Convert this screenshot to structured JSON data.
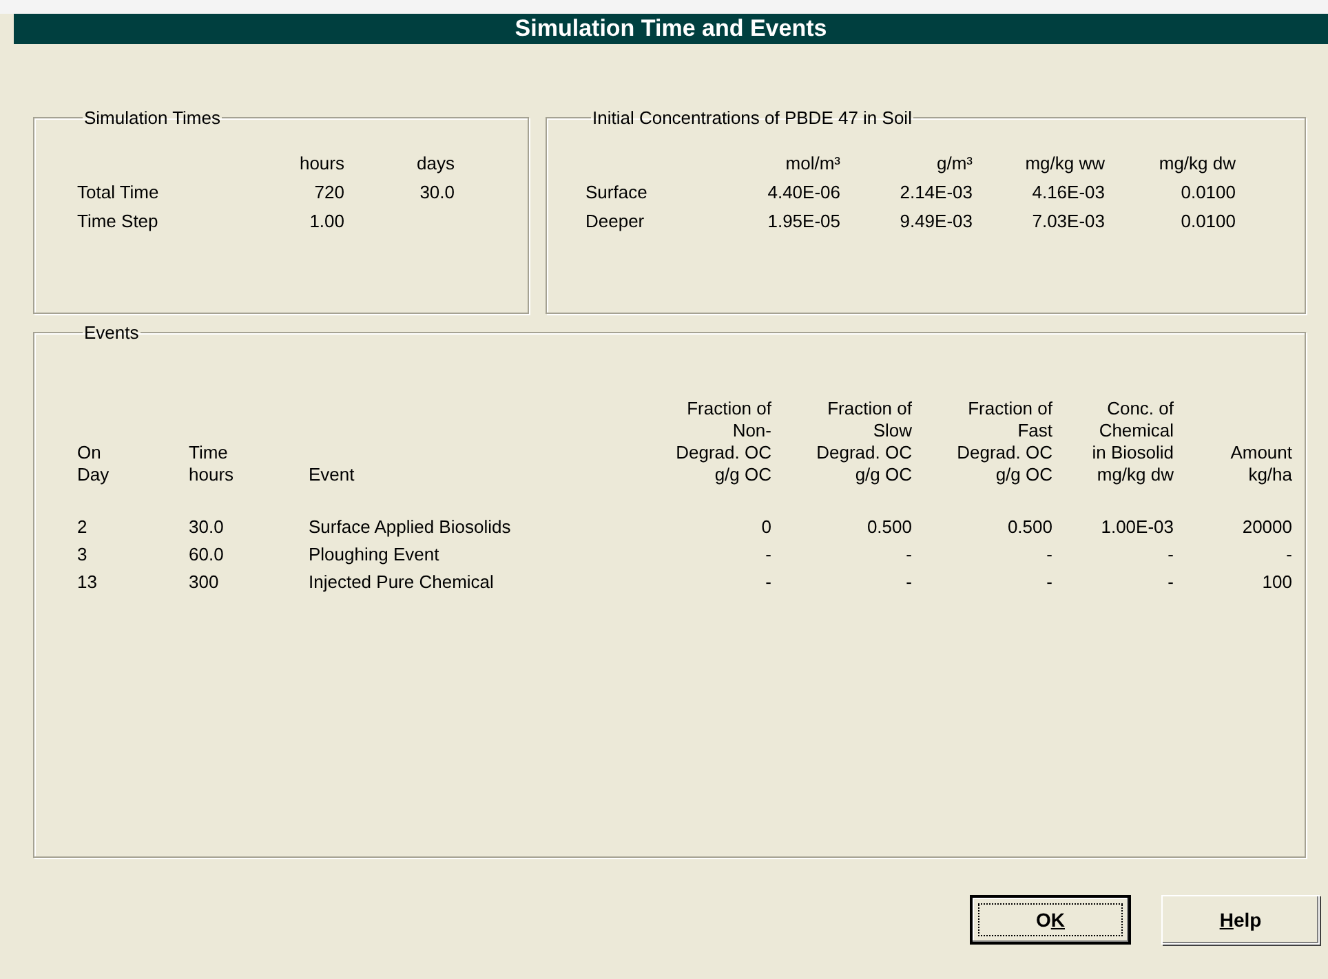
{
  "window": {
    "title": "Simulation Time and Events"
  },
  "simulation_times": {
    "title": "Simulation Times",
    "columns": [
      "hours",
      "days"
    ],
    "rows": [
      {
        "label": "Total Time",
        "values": [
          "720",
          "30.0"
        ]
      },
      {
        "label": "Time Step",
        "values": [
          "1.00"
        ]
      }
    ]
  },
  "initial_concentrations": {
    "title": "Initial Concentrations of PBDE 47 in Soil",
    "columns": [
      "mol/m³",
      "g/m³",
      "mg/kg ww",
      "mg/kg dw"
    ],
    "rows": [
      {
        "label": "Surface",
        "values": [
          "4.40E-06",
          "2.14E-03",
          "4.16E-03",
          "0.0100"
        ]
      },
      {
        "label": "Deeper",
        "values": [
          "1.95E-05",
          "9.49E-03",
          "7.03E-03",
          "0.0100"
        ]
      }
    ]
  },
  "events": {
    "title": "Events",
    "columns": [
      "On\nDay",
      "Time\nhours",
      "Event",
      "Fraction of\nNon-\nDegrad. OC\ng/g OC",
      "Fraction of\nSlow\nDegrad. OC\ng/g OC",
      "Fraction of\nFast\nDegrad. OC\ng/g OC",
      "Conc. of\nChemical\nin Biosolid\nmg/kg dw",
      "Amount\nkg/ha"
    ],
    "rows": [
      [
        "2",
        "30.0",
        "Surface Applied Biosolids",
        "0",
        "0.500",
        "0.500",
        "1.00E-03",
        "20000"
      ],
      [
        "3",
        "60.0",
        "Ploughing Event",
        "-",
        "-",
        "-",
        "-",
        "-"
      ],
      [
        "13",
        "300",
        "Injected Pure Chemical",
        "-",
        "-",
        "-",
        "-",
        "100"
      ]
    ]
  },
  "buttons": [
    {
      "before": "O",
      "key": "K",
      "default": true
    },
    {
      "key": "H",
      "after": "elp",
      "default": false
    }
  ]
}
